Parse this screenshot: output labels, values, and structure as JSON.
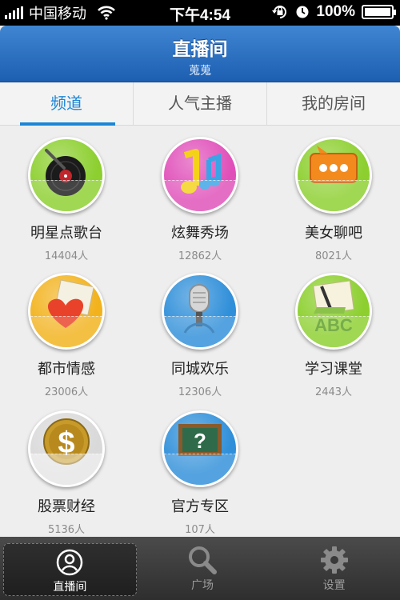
{
  "status_bar": {
    "carrier": "中国移动",
    "time": "下午4:54",
    "battery": "100%",
    "battery_level": 1.0
  },
  "header": {
    "title": "直播间",
    "subtitle": "蒐蒐"
  },
  "tabs": [
    {
      "label": "频道"
    },
    {
      "label": "人气主播"
    },
    {
      "label": "我的房间"
    }
  ],
  "channels": [
    {
      "name": "明星点歌台",
      "count": "14404人",
      "icon": "vinyl-record-icon",
      "color": "#8ccf2e"
    },
    {
      "name": "炫舞秀场",
      "count": "12862人",
      "icon": "music-note-icon",
      "color": "#e04fb9"
    },
    {
      "name": "美女聊吧",
      "count": "8021人",
      "icon": "chat-bubble-icon",
      "color": "#8ccf2e"
    },
    {
      "name": "都市情感",
      "count": "23006人",
      "icon": "heart-letter-icon",
      "color": "#f2b21c"
    },
    {
      "name": "同城欢乐",
      "count": "12306人",
      "icon": "microphone-icon",
      "color": "#2f8fd9"
    },
    {
      "name": "学习课堂",
      "count": "2443人",
      "icon": "abc-notebook-icon",
      "color": "#8ccf2e"
    },
    {
      "name": "股票财经",
      "count": "5136人",
      "icon": "dollar-coin-icon",
      "color": "#d9d9d9"
    },
    {
      "name": "官方专区",
      "count": "107人",
      "icon": "question-board-icon",
      "color": "#2f8fd9"
    }
  ],
  "tabbar": [
    {
      "label": "直播间",
      "icon": "person-icon"
    },
    {
      "label": "广场",
      "icon": "search-icon"
    },
    {
      "label": "设置",
      "icon": "gear-icon"
    }
  ]
}
